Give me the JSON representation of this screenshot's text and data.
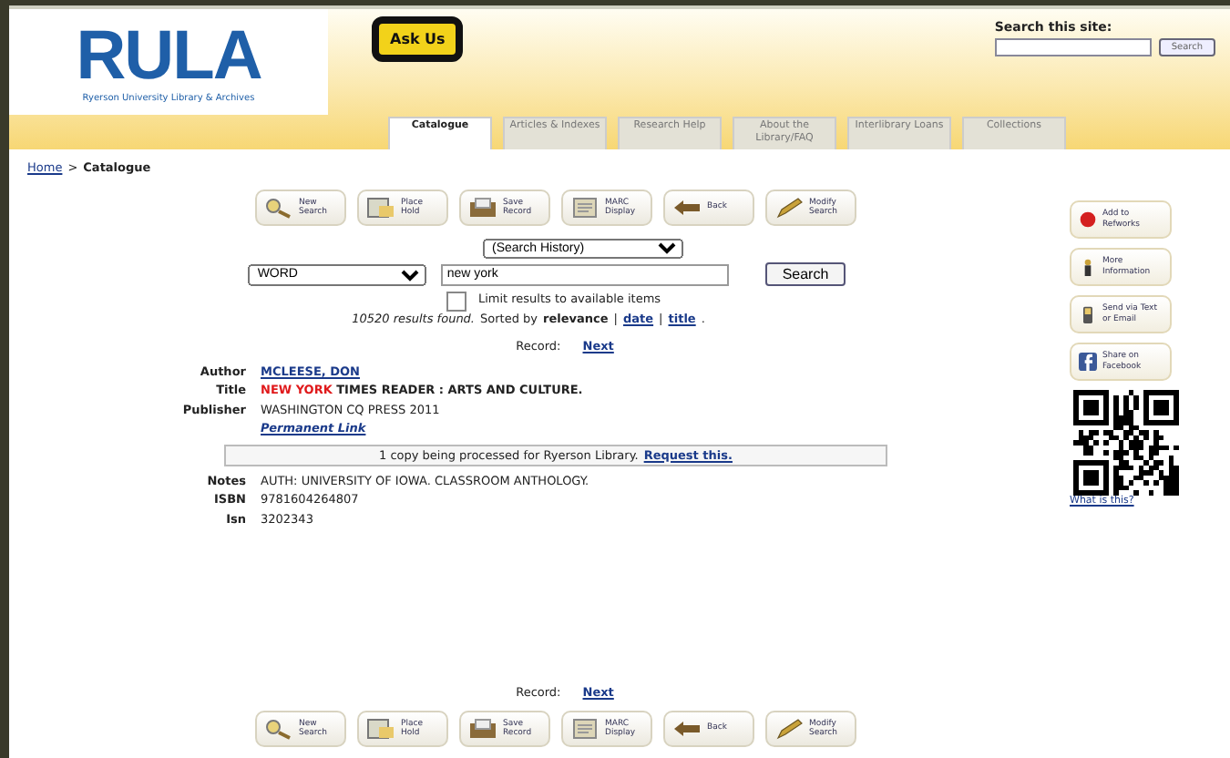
{
  "header": {
    "logo": "RULA",
    "logo_subtitle": "Ryerson University Library & Archives",
    "ask_us": "Ask Us",
    "site_search": {
      "label": "Search this site:",
      "button": "Search"
    }
  },
  "tabs": [
    {
      "label": "Catalogue",
      "selected": true
    },
    {
      "label": "Articles & Indexes",
      "selected": false
    },
    {
      "label": "Research Help",
      "selected": false
    },
    {
      "label": "About the Library/FAQ",
      "selected": false
    },
    {
      "label": "Interlibrary Loans",
      "selected": false
    },
    {
      "label": "Collections",
      "selected": false
    }
  ],
  "breadcrumb": {
    "home": "Home",
    "separator": ">",
    "current": "Catalogue"
  },
  "toolbar_top": [
    {
      "kind": "search",
      "label": "New Search"
    },
    {
      "kind": "hold",
      "label": "Place Hold"
    },
    {
      "kind": "save",
      "label": "Save Record"
    },
    {
      "kind": "marc",
      "label": "MARC Display"
    },
    {
      "kind": "back",
      "label": "Back"
    },
    {
      "kind": "modify",
      "label": "Modify Search"
    }
  ],
  "search_form": {
    "history": "(Search History)",
    "field_type": "WORD",
    "query": "new york",
    "button": "Search",
    "limit": {
      "label": "Limit results to available items",
      "checked": false
    },
    "results": "10520 results found.",
    "sorted_by": "Sorted by",
    "sort_options": [
      {
        "label": "relevance",
        "selected": true
      },
      {
        "label": "date",
        "selected": false
      },
      {
        "label": "title",
        "selected": false
      }
    ],
    "sort_separator": "|",
    "sort_end": "."
  },
  "record_nav_top": {
    "label": "Record:",
    "next": "Next"
  },
  "record": {
    "author_label": "Author",
    "author": "MCLEESE, DON",
    "title_label": "Title",
    "title_parts": [
      {
        "text": "NEW YORK",
        "highlight": true
      },
      {
        "text": " TIMES READER : ARTS AND CULTURE.",
        "highlight": false
      }
    ],
    "publisher_label": "Publisher",
    "publisher": "WASHINGTON CQ PRESS 2011",
    "permanent_link": "Permanent Link",
    "availability": "1 copy being processed for Ryerson Library.",
    "request": "Request this.",
    "fields": [
      {
        "label": "Notes",
        "value": "AUTH: UNIVERSITY OF IOWA. CLASSROOM ANTHOLOGY."
      },
      {
        "label": "ISBN",
        "value": "9781604264807"
      },
      {
        "label": "Isn",
        "value": "3202343"
      }
    ]
  },
  "side_actions": [
    {
      "kind": "refworks",
      "label": "Add to Refworks"
    },
    {
      "kind": "info",
      "label": "More Information"
    },
    {
      "kind": "phone",
      "label": "Send via Text or Email"
    },
    {
      "kind": "facebook",
      "label": "Share on Facebook"
    }
  ],
  "qr_link": "What is this?",
  "record_nav_bottom": {
    "label": "Record:",
    "next": "Next"
  },
  "toolbar_bottom": [
    {
      "kind": "search",
      "label": "New Search"
    },
    {
      "kind": "hold",
      "label": "Place Hold"
    },
    {
      "kind": "save",
      "label": "Save Record"
    },
    {
      "kind": "marc",
      "label": "MARC Display"
    },
    {
      "kind": "back",
      "label": "Back"
    },
    {
      "kind": "modify",
      "label": "Modify Search"
    }
  ]
}
